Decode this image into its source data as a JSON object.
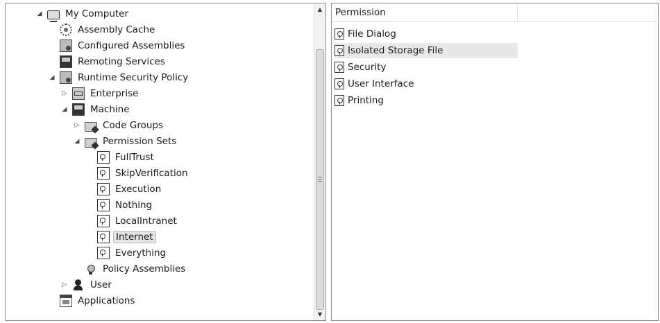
{
  "tree": {
    "items": [
      {
        "label": "My Computer",
        "expander": "expanded",
        "icon": "computer-icon"
      },
      {
        "label": "Assembly Cache",
        "expander": "none",
        "icon": "gear-icon"
      },
      {
        "label": "Configured Assemblies",
        "expander": "none",
        "icon": "assembly-box-icon"
      },
      {
        "label": "Remoting Services",
        "expander": "none",
        "icon": "remoting-icon"
      },
      {
        "label": "Runtime Security Policy",
        "expander": "expanded",
        "icon": "security-policy-icon"
      },
      {
        "label": "Enterprise",
        "expander": "collapsed",
        "icon": "network-icon"
      },
      {
        "label": "Machine",
        "expander": "expanded",
        "icon": "machine-icon"
      },
      {
        "label": "Code Groups",
        "expander": "collapsed",
        "icon": "folder-icon"
      },
      {
        "label": "Permission Sets",
        "expander": "expanded",
        "icon": "permission-sets-icon"
      },
      {
        "label": "FullTrust",
        "expander": "none",
        "icon": "permission-set-icon"
      },
      {
        "label": "SkipVerification",
        "expander": "none",
        "icon": "permission-set-icon"
      },
      {
        "label": "Execution",
        "expander": "none",
        "icon": "permission-set-icon"
      },
      {
        "label": "Nothing",
        "expander": "none",
        "icon": "permission-set-icon"
      },
      {
        "label": "LocalIntranet",
        "expander": "none",
        "icon": "permission-set-icon"
      },
      {
        "label": "Internet",
        "expander": "none",
        "icon": "permission-set-icon",
        "selected": true
      },
      {
        "label": "Everything",
        "expander": "none",
        "icon": "permission-set-icon"
      },
      {
        "label": "Policy Assemblies",
        "expander": "none",
        "icon": "certificate-icon"
      },
      {
        "label": "User",
        "expander": "collapsed",
        "icon": "user-icon"
      },
      {
        "label": "Applications",
        "expander": "none",
        "icon": "applications-icon"
      }
    ]
  },
  "list": {
    "columns": [
      "Permission",
      ""
    ],
    "rows": [
      {
        "label": "File Dialog",
        "icon": "permission-icon"
      },
      {
        "label": "Isolated Storage File",
        "icon": "permission-icon",
        "highlighted": true
      },
      {
        "label": "Security",
        "icon": "permission-icon"
      },
      {
        "label": "User Interface",
        "icon": "permission-icon"
      },
      {
        "label": "Printing",
        "icon": "permission-icon"
      }
    ]
  },
  "scrollbar": {
    "up_glyph": "▲",
    "down_glyph": "▼"
  },
  "colors": {
    "selection": "#e6e6e6",
    "border": "#8a8a8a"
  }
}
